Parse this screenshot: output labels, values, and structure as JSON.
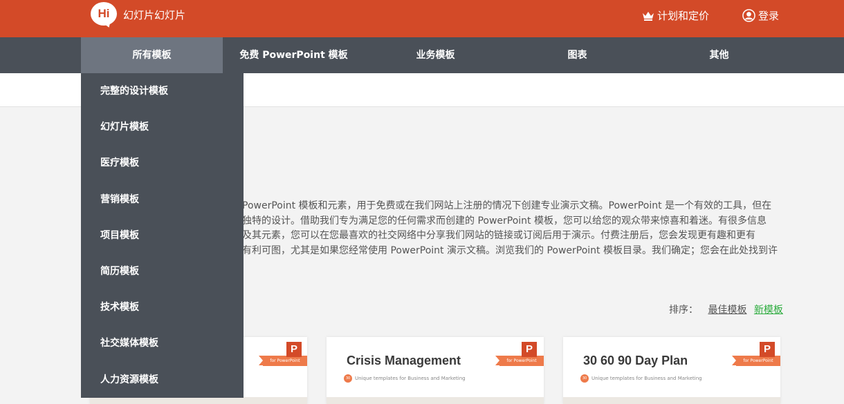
{
  "header": {
    "logo_mark": "Hi",
    "logo_text": "幻灯片幻灯片",
    "plans_label": "计划和定价",
    "login_label": "登录"
  },
  "nav": {
    "items": [
      {
        "label": "所有模板"
      },
      {
        "label": "免费 PowerPoint 模板"
      },
      {
        "label": "业务模板"
      },
      {
        "label": "图表"
      },
      {
        "label": "其他"
      }
    ]
  },
  "dropdown": {
    "items": [
      {
        "label": "完整的设计模板"
      },
      {
        "label": "幻灯片模板"
      },
      {
        "label": "医疗模板"
      },
      {
        "label": "营销模板"
      },
      {
        "label": "项目模板"
      },
      {
        "label": "简历模板"
      },
      {
        "label": "技术模板"
      },
      {
        "label": "社交媒体模板"
      },
      {
        "label": "人力资源模板"
      }
    ]
  },
  "description": {
    "lines": [
      "PowerPoint 模板和元素，用于免费或在我们网站上注册的情况下创建专业演示文稿。PowerPoint 是一个有效的工具，但在",
      "独特的设计。借助我们专为满足您的任何需求而创建的 PowerPoint 模板，您可以给您的观众带来惊喜和着迷。有很多信息",
      "及其元素，您可以在您最喜欢的社交网络中分享我们网站的链接或订阅后用于演示。付费注册后，您会发现更有趣和更有",
      "有利可图，尤其是如果您经常使用 PowerPoint 演示文稿。浏览我们的 PowerPoint 模板目录。我们确定；您会在此处找到许"
    ]
  },
  "sort": {
    "label": "排序：",
    "best": "最佳模板",
    "new": "新模板"
  },
  "cards": [
    {
      "title": "",
      "num": "",
      "subtitle": "",
      "ribbon": "for PowerPoint",
      "p": "P"
    },
    {
      "title": "Crisis Management",
      "num": "30",
      "subtitle": "Unique templates for Business and Marketing",
      "ribbon": "for PowerPoint",
      "p": "P"
    },
    {
      "title": "30 60 90 Day Plan",
      "num": "30",
      "subtitle": "Unique templates for Business and Marketing",
      "ribbon": "for PowerPoint",
      "p": "P"
    }
  ],
  "colors": {
    "brand": "#d34a28",
    "nav_bg": "#4a5058",
    "nav_active": "#6e7580",
    "accent_orange": "#ee7a4a",
    "sort_active": "#2aab3c"
  }
}
